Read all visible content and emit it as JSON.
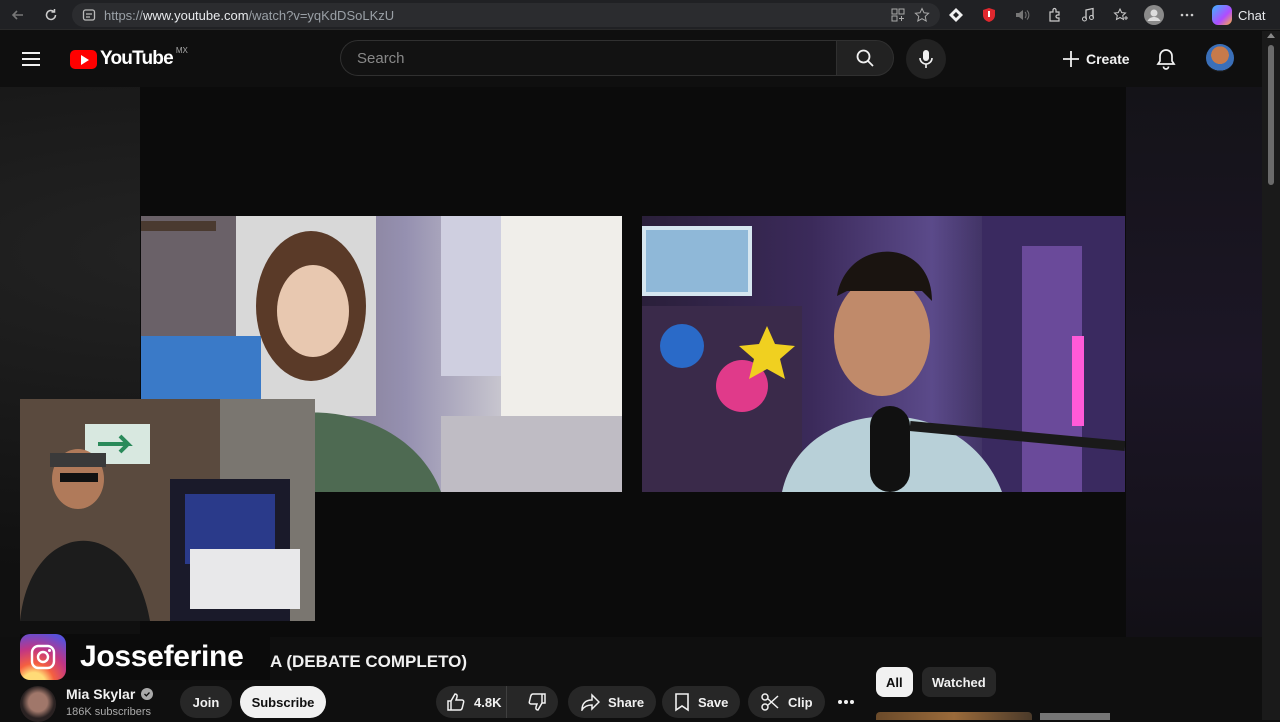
{
  "browser": {
    "url_prefix": "https://",
    "url_host": "www.youtube.com",
    "url_path": "/watch?v=yqKdDSoLKzU",
    "chat_label": "Chat"
  },
  "header": {
    "logo_text": "YouTube",
    "country_code": "MX",
    "search_placeholder": "Search",
    "create_label": "Create"
  },
  "overlay": {
    "instagram_handle": "Josseferine"
  },
  "video": {
    "title_visible": "A (DEBATE COMPLETO)",
    "channel_name": "Mia Skylar",
    "subscribers": "186K subscribers",
    "join_label": "Join",
    "subscribe_label": "Subscribe",
    "likes": "4.8K",
    "share_label": "Share",
    "save_label": "Save",
    "clip_label": "Clip"
  },
  "sidebar": {
    "chips": [
      "All",
      "Watched"
    ]
  },
  "colors": {
    "background": "#0f0f0f",
    "yt_red": "#ff0000",
    "button_bg": "#272727",
    "subscribe_bg": "#f1f1f1"
  }
}
